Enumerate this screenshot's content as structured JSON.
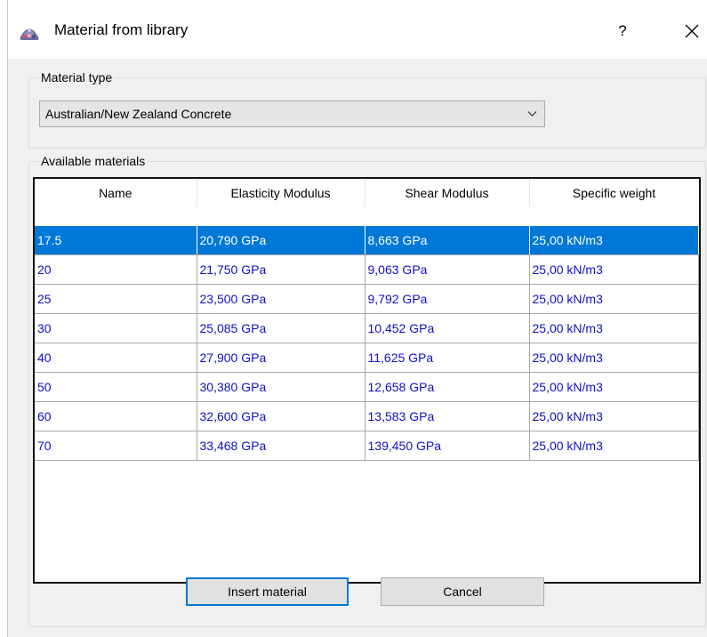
{
  "window": {
    "title": "Material from library",
    "help_label": "?",
    "icon": "material-library-app-icon"
  },
  "material_type": {
    "group_label": "Material type",
    "selected": "Australian/New Zealand Concrete"
  },
  "available": {
    "group_label": "Available materials",
    "columns": [
      "Name",
      "Elasticity Modulus",
      "Shear Modulus",
      "Specific weight"
    ],
    "rows": [
      [
        "17.5",
        "20,790 GPa",
        "8,663 GPa",
        "25,00 kN/m3"
      ],
      [
        "20",
        "21,750 GPa",
        "9,063 GPa",
        "25,00 kN/m3"
      ],
      [
        "25",
        "23,500 GPa",
        "9,792 GPa",
        "25,00 kN/m3"
      ],
      [
        "30",
        "25,085 GPa",
        "10,452 GPa",
        "25,00 kN/m3"
      ],
      [
        "40",
        "27,900 GPa",
        "11,625 GPa",
        "25,00 kN/m3"
      ],
      [
        "50",
        "30,380 GPa",
        "12,658 GPa",
        "25,00 kN/m3"
      ],
      [
        "60",
        "32,600 GPa",
        "13,583 GPa",
        "25,00 kN/m3"
      ],
      [
        "70",
        "33,468 GPa",
        "139,450 GPa",
        "25,00 kN/m3"
      ]
    ],
    "selected_row": 0
  },
  "buttons": {
    "insert": "Insert material",
    "cancel": "Cancel"
  },
  "colors": {
    "selection": "#0078d7",
    "cell_text": "#1010c8",
    "dialog_bg": "#f0f0f0"
  }
}
